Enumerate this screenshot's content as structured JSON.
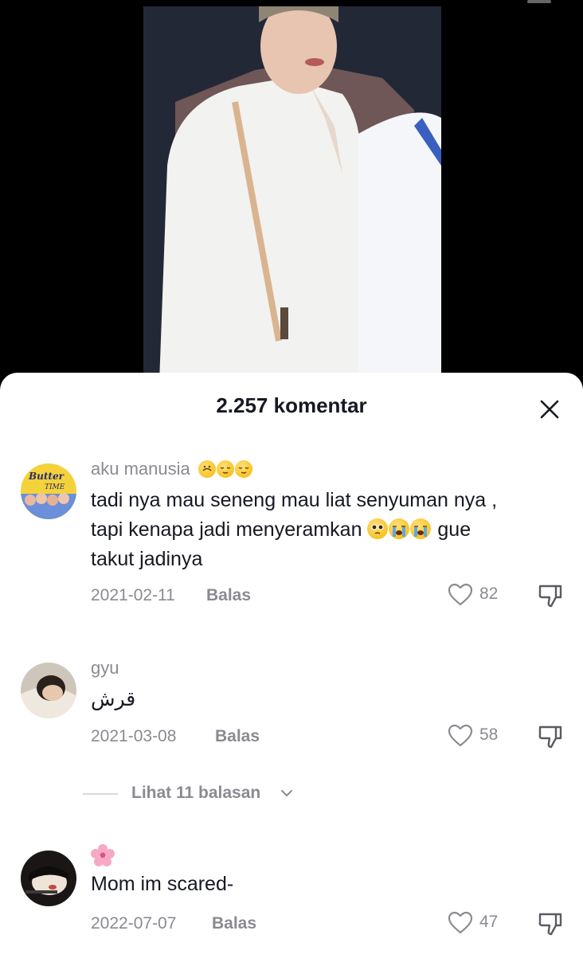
{
  "sheet": {
    "comment_count": "2.257 komentar"
  },
  "comments": [
    {
      "username": "aku manusia",
      "username_emoji": [
        "upside-down-face",
        "relieved-face",
        "relieved-face"
      ],
      "text_lines": [
        "tadi nya mau seneng mau liat senyuman nya ,",
        "tapi kenapa jadi menyeramkan",
        "gue",
        "takut jadinya"
      ],
      "text_emoji": [
        "pleading-face",
        "crying-face",
        "crying-face"
      ],
      "date": "2021-02-11",
      "reply_label": "Balas",
      "likes": "82"
    },
    {
      "username": "gyu",
      "text": "قرش",
      "date": "2021-03-08",
      "reply_label": "Balas",
      "likes": "58",
      "view_replies": "Lihat 11 balasan"
    },
    {
      "username_icon": "hibiscus-icon",
      "text": "Mom im scared-",
      "date": "2022-07-07",
      "reply_label": "Balas",
      "likes": "47"
    }
  ],
  "avatar1_text": [
    "Butter",
    "TIME"
  ],
  "colors": {
    "text_primary": "#161823",
    "text_secondary": "#8a8b91",
    "sheet_bg": "#ffffff",
    "video_bg": "#000000"
  }
}
